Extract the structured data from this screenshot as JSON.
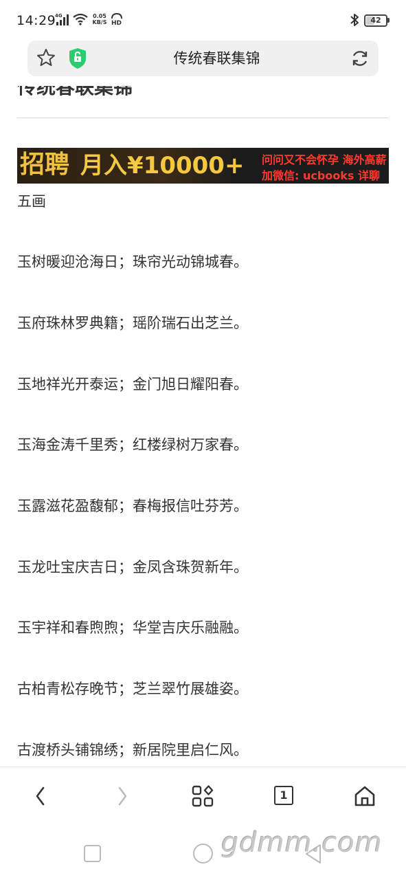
{
  "status_bar": {
    "time": "14:29",
    "net_speed_value": "0.05",
    "net_speed_unit": "KB/S",
    "battery": "42",
    "signal_label": "4G"
  },
  "address_bar": {
    "title": "传统春联集锦"
  },
  "content": {
    "heading": "传统春联集锦",
    "ad": {
      "left_text": "招聘",
      "main_text": "月入¥10000+",
      "line1": "问问又不会怀孕 海外高薪",
      "line2": "加微信: ucbooks 详聊"
    },
    "section_label": "五画",
    "couplets": [
      "玉树暖迎沧海日；珠帘光动锦城春。",
      "玉府珠林罗典籍；瑶阶瑞石出芝兰。",
      "玉地祥光开泰运；金门旭日耀阳春。",
      "玉海金涛千里秀；红楼绿树万家春。",
      "玉露滋花盈馥郁；春梅报信吐芬芳。",
      "玉龙吐宝庆吉日；金凤含珠贺新年。",
      "玉宇祥和春煦煦；华堂吉庆乐融融。",
      "古柏青松存晚节；芝兰翠竹展雄姿。",
      "古渡桥头铺锦绣；新居院里启仁风。"
    ]
  },
  "bottom_nav": {
    "tab_count": "1"
  },
  "watermark": "gdmm.com",
  "colors": {
    "accent_green": "#2ecc71",
    "ad_gold": "#f5c842",
    "ad_red": "#ff3b30"
  }
}
